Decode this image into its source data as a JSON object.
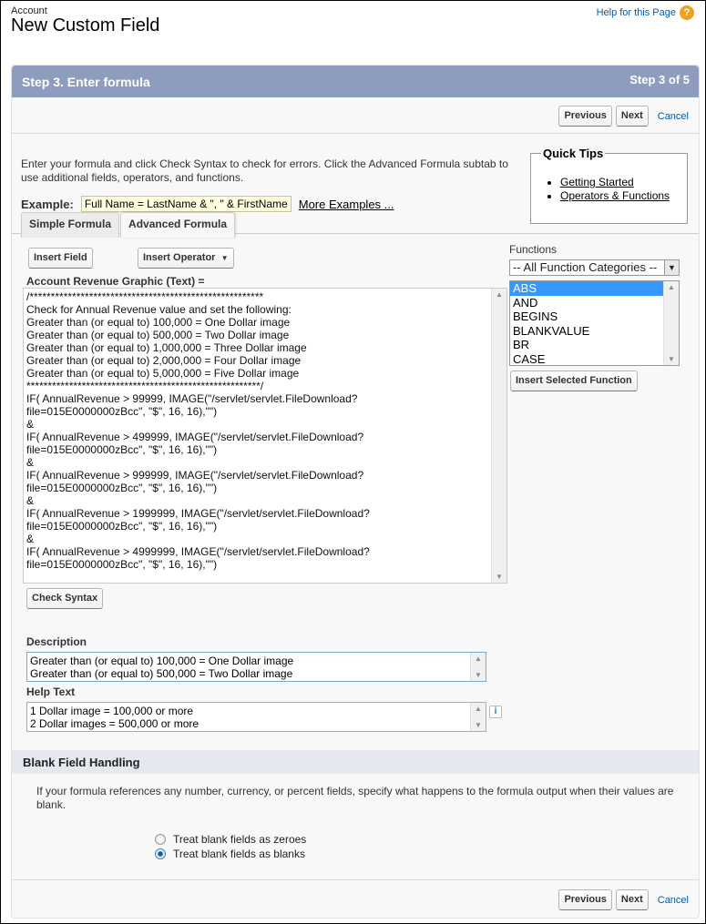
{
  "header": {
    "object_label": "Account",
    "page_title": "New Custom Field",
    "help_link": "Help for this Page",
    "help_icon": "?"
  },
  "panel": {
    "title": "Step 3. Enter formula",
    "step_indicator": "Step 3 of 5"
  },
  "nav_buttons": {
    "previous": "Previous",
    "next": "Next",
    "cancel": "Cancel"
  },
  "intro_text": "Enter your formula and click Check Syntax to check for errors. Click the Advanced Formula subtab to use additional fields, operators, and functions.",
  "quick_tips": {
    "title": "Quick Tips",
    "links": [
      "Getting Started",
      "Operators & Functions"
    ]
  },
  "example": {
    "label": "Example:",
    "value": "Full Name = LastName & \", \" & FirstName",
    "more_link": "More Examples ..."
  },
  "tabs": [
    {
      "label": "Simple Formula",
      "active": false
    },
    {
      "label": "Advanced Formula",
      "active": true
    }
  ],
  "formula_toolbar": {
    "insert_field": "Insert Field",
    "insert_operator": "Insert Operator",
    "insert_operator_arrow": "▼"
  },
  "formula": {
    "label": "Account Revenue Graphic (Text) =",
    "value": "/*******************************************************\nCheck for Annual Revenue value and set the following:\nGreater than (or equal to) 100,000 = One Dollar image\nGreater than (or equal to) 500,000 = Two Dollar image\nGreater than (or equal to) 1,000,000 = Three Dollar image\nGreater than (or equal to) 2,000,000 = Four Dollar image\nGreater than (or equal to) 5,000,000 = Five Dollar image\n*******************************************************/\nIF( AnnualRevenue > 99999, IMAGE(\"/servlet/servlet.FileDownload?\nfile=015E0000000zBcc\", \"$\", 16, 16),\"\")\n&\nIF( AnnualRevenue > 499999, IMAGE(\"/servlet/servlet.FileDownload?\nfile=015E0000000zBcc\", \"$\", 16, 16),\"\")\n&\nIF( AnnualRevenue > 999999, IMAGE(\"/servlet/servlet.FileDownload?\nfile=015E0000000zBcc\", \"$\", 16, 16),\"\")\n&\nIF( AnnualRevenue > 1999999, IMAGE(\"/servlet/servlet.FileDownload?\nfile=015E0000000zBcc\", \"$\", 16, 16),\"\")\n&\nIF( AnnualRevenue > 4999999, IMAGE(\"/servlet/servlet.FileDownload?\nfile=015E0000000zBcc\", \"$\", 16, 16),\"\")",
    "check_syntax": "Check Syntax"
  },
  "functions": {
    "label": "Functions",
    "category_selected": "-- All Function Categories --",
    "items": [
      "ABS",
      "AND",
      "BEGINS",
      "BLANKVALUE",
      "BR",
      "CASE"
    ],
    "selected": "ABS",
    "insert_button": "Insert Selected Function"
  },
  "description": {
    "label": "Description",
    "value": "Greater than (or equal to) 100,000 = One Dollar image\nGreater than (or equal to) 500,000 = Two Dollar image"
  },
  "help_text": {
    "label": "Help Text",
    "value": "1 Dollar image = 100,000 or more\n2 Dollar images = 500,000 or more",
    "info_icon": "i"
  },
  "blank_handling": {
    "title": "Blank Field Handling",
    "description": "If your formula references any number, currency, or percent fields, specify what happens to the formula output when their values are blank.",
    "options": [
      {
        "label": "Treat blank fields as zeroes",
        "checked": false
      },
      {
        "label": "Treat blank fields as blanks",
        "checked": true
      }
    ]
  }
}
